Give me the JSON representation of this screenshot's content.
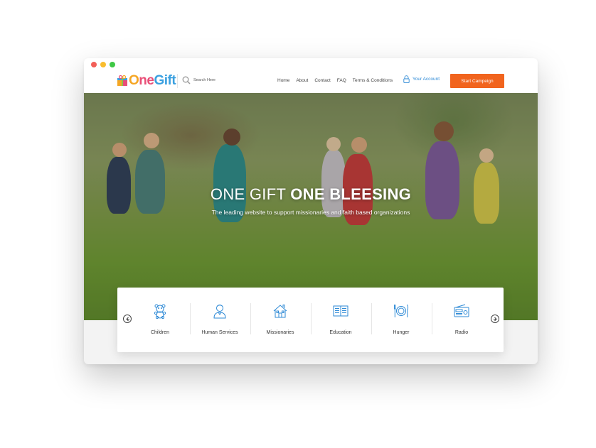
{
  "brand": {
    "logo_parts": [
      "O",
      "ne",
      "Gift"
    ],
    "colors": {
      "orange": "#f5a623",
      "pink": "#e94e77",
      "blue": "#3aa0e0",
      "cta": "#f1641e"
    }
  },
  "search": {
    "placeholder": "Search Here"
  },
  "nav": {
    "links": [
      "Home",
      "About",
      "Contact",
      "FAQ",
      "Terms & Conditions"
    ],
    "account_label": "Your Account",
    "cta_label": "Start Campeign"
  },
  "hero": {
    "title_light": "ONE GIFT",
    "title_bold": "ONE BLEESING",
    "subtitle": "The leading website to support missionaries and faith based organizations"
  },
  "categories": [
    {
      "label": "Children",
      "icon": "teddy-bear-icon"
    },
    {
      "label": "Human Services",
      "icon": "person-icon"
    },
    {
      "label": "Missionaries",
      "icon": "house-icon"
    },
    {
      "label": "Education",
      "icon": "book-icon"
    },
    {
      "label": "Hunger",
      "icon": "plate-cutlery-icon"
    },
    {
      "label": "Radio",
      "icon": "radio-icon"
    }
  ]
}
